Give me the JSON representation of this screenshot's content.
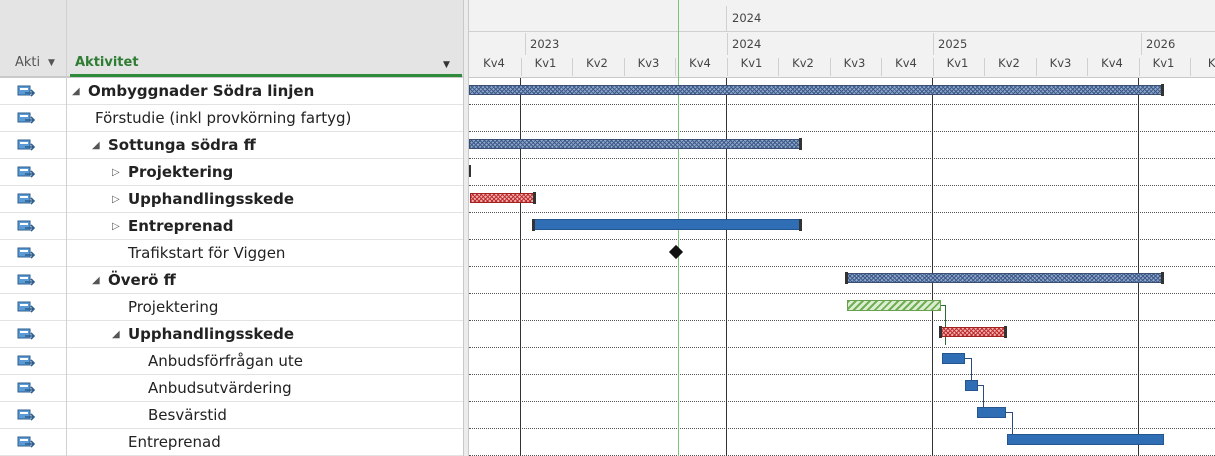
{
  "table": {
    "col_aktiv": "Akti",
    "col_name": "Aktivitet",
    "rows": [
      {
        "label": "Ombyggnader Södra linjen",
        "bold": true,
        "expander": "◢",
        "indent": 0
      },
      {
        "label": "Förstudie (inkl provkörning fartyg)",
        "bold": false,
        "expander": "",
        "indent": 1
      },
      {
        "label": "Sottunga södra ff",
        "bold": true,
        "expander": "◢",
        "indent": 1
      },
      {
        "label": "Projektering",
        "bold": true,
        "expander": "▷",
        "indent": 2
      },
      {
        "label": "Upphandlingsskede",
        "bold": true,
        "expander": "▷",
        "indent": 2
      },
      {
        "label": "Entreprenad",
        "bold": true,
        "expander": "▷",
        "indent": 2
      },
      {
        "label": "Trafikstart för Viggen",
        "bold": false,
        "expander": "",
        "indent": 2
      },
      {
        "label": "Överö ff",
        "bold": true,
        "expander": "◢",
        "indent": 1
      },
      {
        "label": "Projektering",
        "bold": false,
        "expander": "",
        "indent": 2
      },
      {
        "label": "Upphandlingsskede",
        "bold": true,
        "expander": "◢",
        "indent": 2
      },
      {
        "label": "Anbudsförfrågan ute",
        "bold": false,
        "expander": "",
        "indent": 3
      },
      {
        "label": "Anbudsutvärdering",
        "bold": false,
        "expander": "",
        "indent": 3
      },
      {
        "label": "Besvärstid",
        "bold": false,
        "expander": "",
        "indent": 3
      },
      {
        "label": "Entreprenad",
        "bold": false,
        "expander": "",
        "indent": 2
      }
    ]
  },
  "timescale": {
    "top_tier": "2024",
    "years": [
      "2023",
      "2024",
      "2025",
      "2026"
    ],
    "quarters": [
      "Kv4",
      "Kv1",
      "Kv2",
      "Kv3",
      "Kv4",
      "Kv1",
      "Kv2",
      "Kv3",
      "Kv4",
      "Kv1",
      "Kv2",
      "Kv3",
      "Kv4",
      "Kv1",
      "Kv"
    ]
  },
  "colors": {
    "summary": "#3d5a8a",
    "critical": "#c03030",
    "task": "#2f6db5",
    "progress_hatch": "#6fae52",
    "today_line": "#7cc47c",
    "header_accent": "#2e8b3b"
  },
  "icons": {
    "row_icon": "auto-scheduled-task-icon",
    "dropdown": "chevron-down-icon"
  }
}
